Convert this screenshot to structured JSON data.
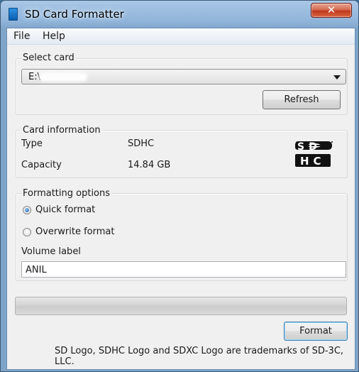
{
  "window": {
    "title": "SD Card Formatter",
    "close_symbol": "✕"
  },
  "menu": {
    "items": [
      "File",
      "Help"
    ]
  },
  "select_card": {
    "legend": "Select card",
    "selected_value": "E:\\",
    "refresh_label": "Refresh"
  },
  "card_info": {
    "legend": "Card information",
    "type_label": "Type",
    "type_value": "SDHC",
    "capacity_label": "Capacity",
    "capacity_value": "14.84 GB",
    "logo_text_top": "SD",
    "logo_text_bottom": "HC"
  },
  "formatting": {
    "legend": "Formatting options",
    "quick_format_label": "Quick format",
    "overwrite_format_label": "Overwrite format",
    "selected_option": "quick",
    "volume_label_caption": "Volume label",
    "volume_label_value": "ANIL"
  },
  "progress": {
    "value": 0
  },
  "actions": {
    "format_label": "Format"
  },
  "footer": {
    "text": "SD Logo, SDHC Logo and SDXC Logo are trademarks of SD-3C, LLC."
  },
  "colors": {
    "titlebar": "#8fb3d9",
    "close_button": "#c0391f",
    "client_bg": "#f0f0f0",
    "progress_fill": "#37b037"
  }
}
